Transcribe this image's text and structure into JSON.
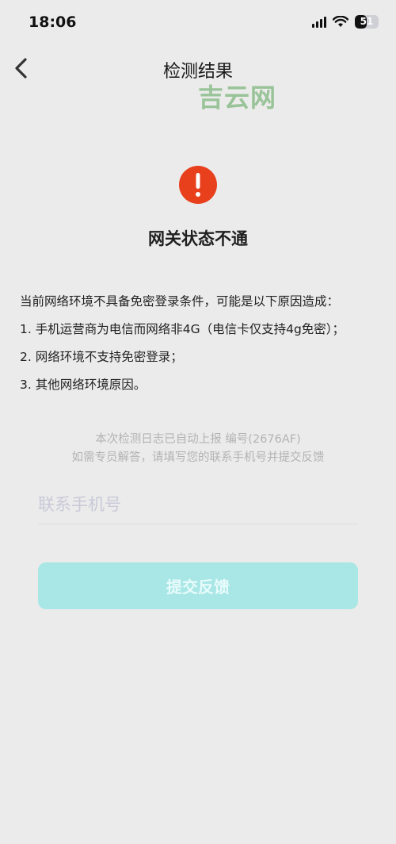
{
  "status_bar": {
    "time": "18:06",
    "battery_level": "51",
    "battery_fraction": 0.51
  },
  "nav": {
    "title": "检测结果",
    "back_icon": "chevron-left-icon"
  },
  "watermark": "吉云网",
  "alert": {
    "icon": "exclamation-circle-icon",
    "color": "#e8401d",
    "title": "网关状态不通"
  },
  "reasons": {
    "intro": "当前网络环境不具备免密登录条件，可能是以下原因造成：",
    "items": [
      "1. 手机运营商为电信而网络非4G（电信卡仅支持4g免密）；",
      "2. 网络环境不支持免密登录；",
      "3. 其他网络环境原因。"
    ]
  },
  "log_info": {
    "line1": "本次检测日志已自动上报 编号(2676AF)",
    "line2": "如需专员解答，请填写您的联系手机号并提交反馈"
  },
  "phone": {
    "value": "",
    "placeholder": "联系手机号"
  },
  "submit": {
    "label": "提交反馈",
    "color": "#a9e6e6"
  }
}
